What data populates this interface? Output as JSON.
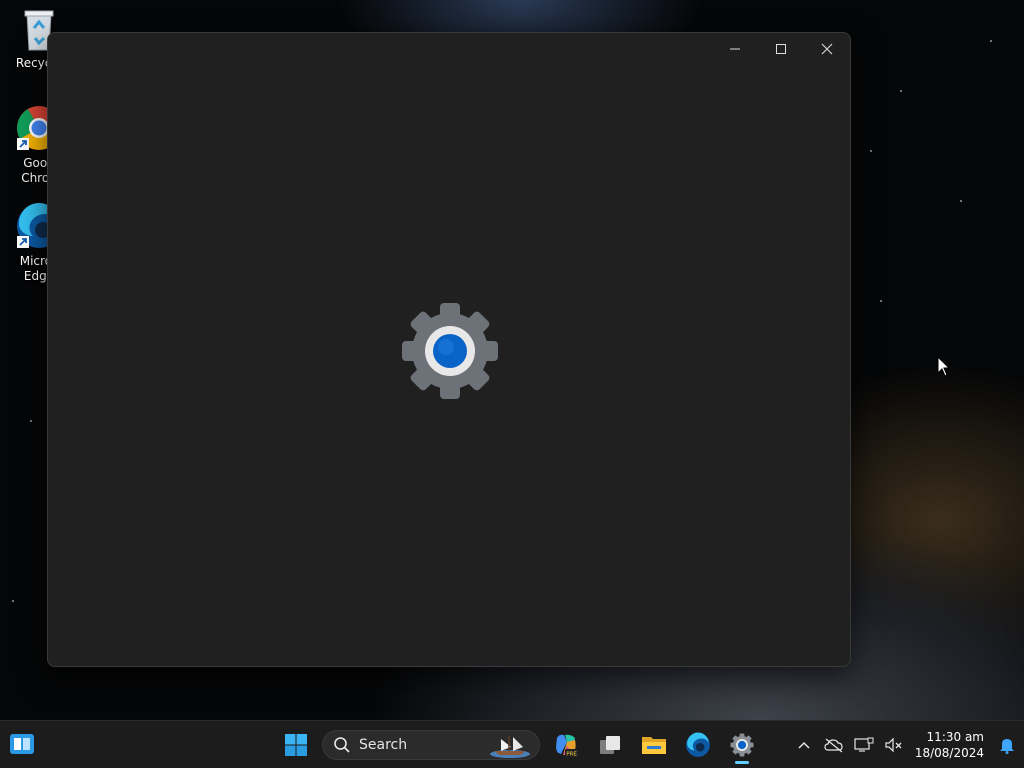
{
  "desktop": {
    "icons": [
      {
        "name": "recycle-bin",
        "label": "Recycle"
      },
      {
        "name": "google-chrome",
        "label": "Goog\nChron"
      },
      {
        "name": "microsoft-edge",
        "label": "Micros\nEdge"
      }
    ]
  },
  "window": {
    "app_icon": "settings-gear-icon",
    "caption": {
      "minimize_icon": "minimize-icon",
      "maximize_icon": "maximize-icon",
      "close_icon": "close-icon"
    }
  },
  "taskbar": {
    "search_placeholder": "Search",
    "pinned": [
      "start",
      "copilot",
      "task-view",
      "file-explorer",
      "edge",
      "settings"
    ],
    "active_app": "settings"
  },
  "tray": {
    "time": "11:30 am",
    "date": "18/08/2024"
  },
  "colors": {
    "accent": "#0a64c8",
    "window_bg": "#202020",
    "taskbar_bg": "#1c1c1c",
    "active_indicator": "#60cdff"
  }
}
